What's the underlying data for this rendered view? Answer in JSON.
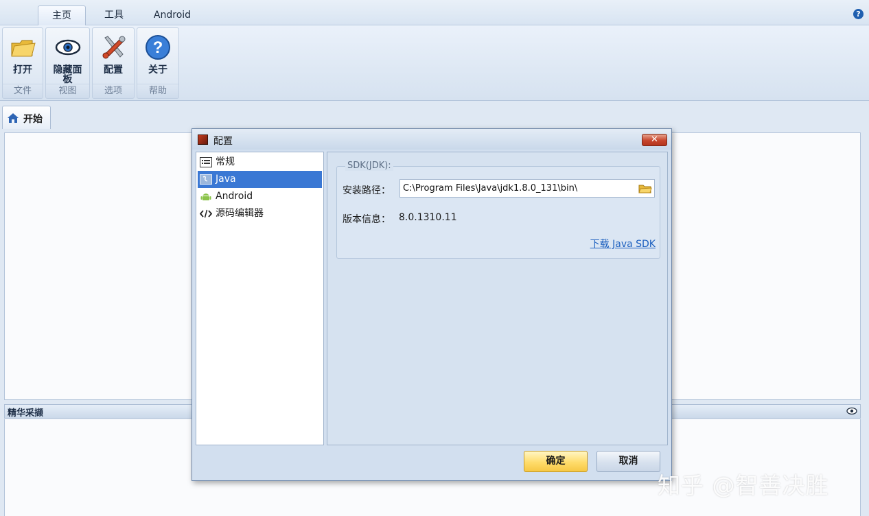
{
  "ribbon": {
    "tabs": [
      "主页",
      "工具",
      "Android"
    ],
    "active_tab": "主页",
    "groups": [
      {
        "button_label": "打开",
        "group_label": "文件",
        "icon": "open-folder-icon"
      },
      {
        "button_label": "隐藏面板",
        "group_label": "视图",
        "icon": "eye-icon"
      },
      {
        "button_label": "配置",
        "group_label": "选项",
        "icon": "tools-icon"
      },
      {
        "button_label": "关于",
        "group_label": "帮助",
        "icon": "help-icon"
      }
    ],
    "help_icon": "?"
  },
  "document": {
    "tab_label": "开始",
    "tab_icon": "home-icon"
  },
  "bottom_panel": {
    "title": "精华采撷",
    "toggle_icon": "eye-icon"
  },
  "dialog": {
    "title": "配置",
    "close_label": "✕",
    "nav_items": [
      {
        "label": "常规",
        "icon": "list-icon",
        "selected": false
      },
      {
        "label": "Java",
        "icon": "java-icon",
        "selected": true
      },
      {
        "label": "Android",
        "icon": "android-icon",
        "selected": false
      },
      {
        "label": "源码编辑器",
        "icon": "code-icon",
        "selected": false
      }
    ],
    "sdk_group_title": "SDK(JDK):",
    "install_path_label": "安装路径：",
    "install_path_value": "C:\\Program Files\\Java\\jdk1.8.0_131\\bin\\",
    "version_label": "版本信息：",
    "version_value": "8.0.1310.11",
    "download_link": "下载 Java SDK",
    "ok_label": "确定",
    "cancel_label": "取消"
  },
  "watermark": "知乎 @智善决胜",
  "colors": {
    "selection": "#3a78d4",
    "ok_button": "#ffdc6b",
    "link": "#1b5fbf",
    "close_button": "#c7452c"
  }
}
